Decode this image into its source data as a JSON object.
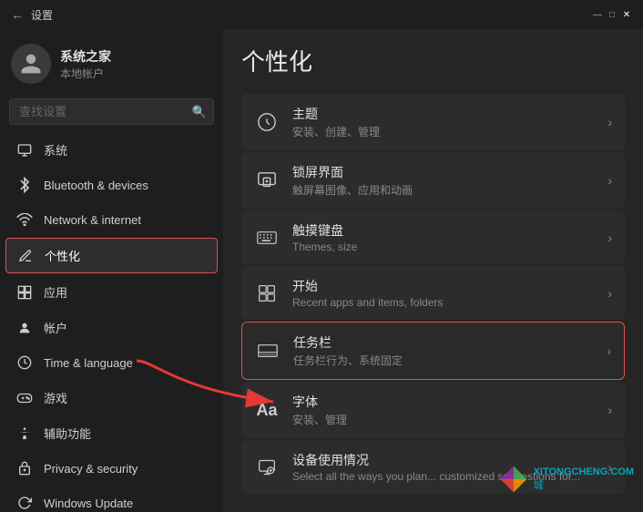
{
  "titlebar": {
    "back_icon": "←",
    "title": "设置"
  },
  "user": {
    "name": "系统之家",
    "type": "本地帐户"
  },
  "search": {
    "placeholder": "查找设置"
  },
  "nav": {
    "items": [
      {
        "id": "system",
        "label": "系统",
        "icon": "⊞"
      },
      {
        "id": "bluetooth",
        "label": "Bluetooth & devices",
        "icon": "⚡"
      },
      {
        "id": "network",
        "label": "Network & internet",
        "icon": "🌐"
      },
      {
        "id": "personalization",
        "label": "个性化",
        "icon": "✏️",
        "active": true
      },
      {
        "id": "apps",
        "label": "应用",
        "icon": "📦"
      },
      {
        "id": "accounts",
        "label": "帐户",
        "icon": "👤"
      },
      {
        "id": "time",
        "label": "Time & language",
        "icon": "🕐"
      },
      {
        "id": "gaming",
        "label": "游戏",
        "icon": "🎮"
      },
      {
        "id": "accessibility",
        "label": "辅助功能",
        "icon": "♿"
      },
      {
        "id": "privacy",
        "label": "Privacy & security",
        "icon": "🔒"
      },
      {
        "id": "windows-update",
        "label": "Windows Update",
        "icon": "🔄"
      }
    ]
  },
  "main": {
    "title": "个性化",
    "settings": [
      {
        "id": "theme",
        "label": "主题",
        "desc": "安装、创建、管理",
        "icon": "theme"
      },
      {
        "id": "lockscreen",
        "label": "锁屏界面",
        "desc": "触屏幕图像、应用和动画",
        "icon": "lockscreen"
      },
      {
        "id": "touch-keyboard",
        "label": "触摸键盘",
        "desc": "Themes, size",
        "icon": "keyboard"
      },
      {
        "id": "start",
        "label": "开始",
        "desc": "Recent apps and items, folders",
        "icon": "start"
      },
      {
        "id": "taskbar",
        "label": "任务栏",
        "desc": "任务栏行为、系统固定",
        "icon": "taskbar",
        "highlighted": true
      },
      {
        "id": "fonts",
        "label": "字体",
        "desc": "安装、管理",
        "icon": "fonts"
      },
      {
        "id": "device-usage",
        "label": "设备使用情况",
        "desc": "Select all the ways you plan... customized suggestions for...",
        "icon": "device"
      }
    ]
  },
  "watermark": {
    "text1": "XITONGCHENG.COM",
    "text2": "城"
  }
}
